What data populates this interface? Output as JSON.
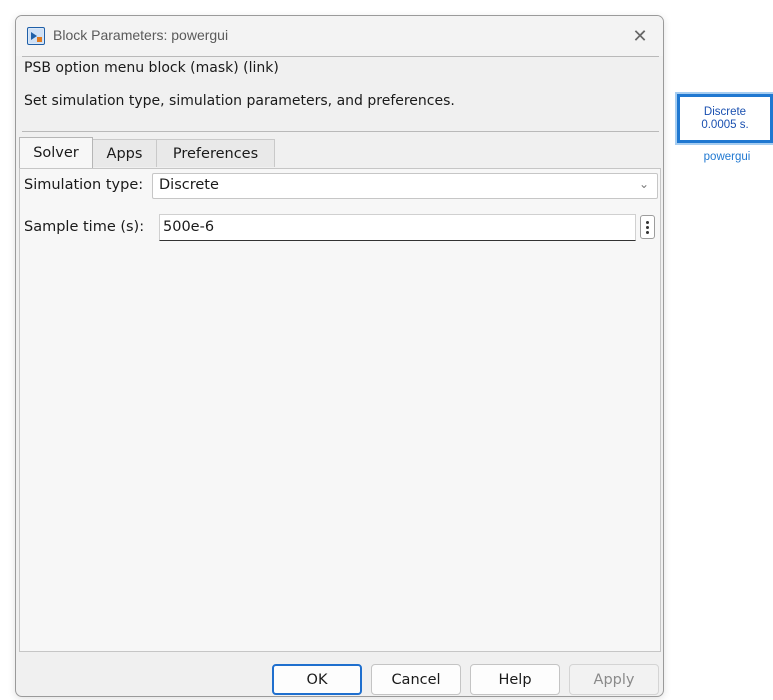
{
  "dialog": {
    "title": "Block Parameters: powergui",
    "close_glyph": "✕",
    "description": {
      "group_title": "PSB option menu block (mask) (link)",
      "text": "Set simulation type, simulation parameters, and preferences."
    },
    "tabs": [
      {
        "label": "Solver",
        "active": true
      },
      {
        "label": "Apps",
        "active": false
      },
      {
        "label": "Preferences",
        "active": false
      }
    ],
    "fields": {
      "simulation_type": {
        "label": "Simulation type:",
        "value": "Discrete"
      },
      "sample_time": {
        "label": "Sample time (s):",
        "value": "500e-6"
      }
    },
    "buttons": {
      "ok": "OK",
      "cancel": "Cancel",
      "help": "Help",
      "apply": "Apply"
    }
  },
  "block": {
    "line1": "Discrete",
    "line2": "0.0005 s.",
    "name": "powergui"
  },
  "colors": {
    "accent": "#1f78d1",
    "block_text": "#1a50b0",
    "ok_border": "#1f6fce"
  },
  "icons": [
    "simulink-block-icon",
    "close-icon",
    "chevron-down-icon",
    "kebab-menu-icon"
  ]
}
